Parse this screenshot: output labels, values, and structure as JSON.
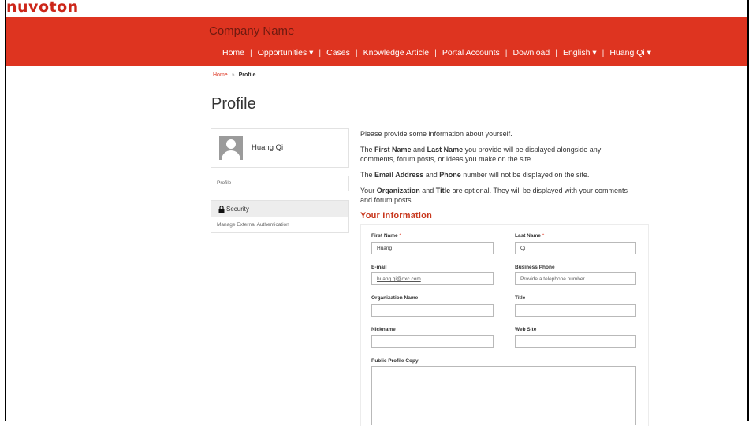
{
  "brand": {
    "logo_text": "nuvoton",
    "accent": "#de3420"
  },
  "header": {
    "company_name": "Company Name",
    "nav": [
      "Home",
      "Opportunities ▾",
      "Cases",
      "Knowledge Article",
      "Portal Accounts",
      "Download",
      "English ▾",
      "Huang Qi ▾"
    ]
  },
  "breadcrumb": {
    "home": "Home",
    "separator": "»",
    "current": "Profile"
  },
  "page_title": "Profile",
  "sidebar": {
    "user_name": "Huang Qi",
    "profile_link": "Profile",
    "security_heading": "Security",
    "security_item": "Manage External Authentication"
  },
  "intro": {
    "p1": "Please provide some information about yourself.",
    "p2_pre": "The ",
    "p2_b1": "First Name",
    "p2_mid": " and ",
    "p2_b2": "Last Name",
    "p2_post": " you provide will be displayed alongside any comments, forum posts, or ideas you make on the site.",
    "p3_pre": "The ",
    "p3_b1": "Email Address",
    "p3_mid": " and ",
    "p3_b2": "Phone",
    "p3_post": " number will not be displayed on the site.",
    "p4_pre": "Your ",
    "p4_b1": "Organization",
    "p4_mid": " and ",
    "p4_b2": "Title",
    "p4_post": " are optional. They will be displayed with your comments and forum posts."
  },
  "section_title": "Your Information",
  "form": {
    "first_name": {
      "label": "First Name",
      "required": "*",
      "value": "Huang"
    },
    "last_name": {
      "label": "Last Name",
      "required": "*",
      "value": "Qi"
    },
    "email": {
      "label": "E-mail",
      "value": "huang.qi@dxc.com"
    },
    "business_phone": {
      "label": "Business Phone",
      "placeholder": "Provide a telephone number"
    },
    "organization": {
      "label": "Organization Name",
      "value": ""
    },
    "title": {
      "label": "Title",
      "value": ""
    },
    "nickname": {
      "label": "Nickname",
      "value": ""
    },
    "website": {
      "label": "Web Site",
      "value": ""
    },
    "public_profile": {
      "label": "Public Profile Copy",
      "value": ""
    }
  }
}
